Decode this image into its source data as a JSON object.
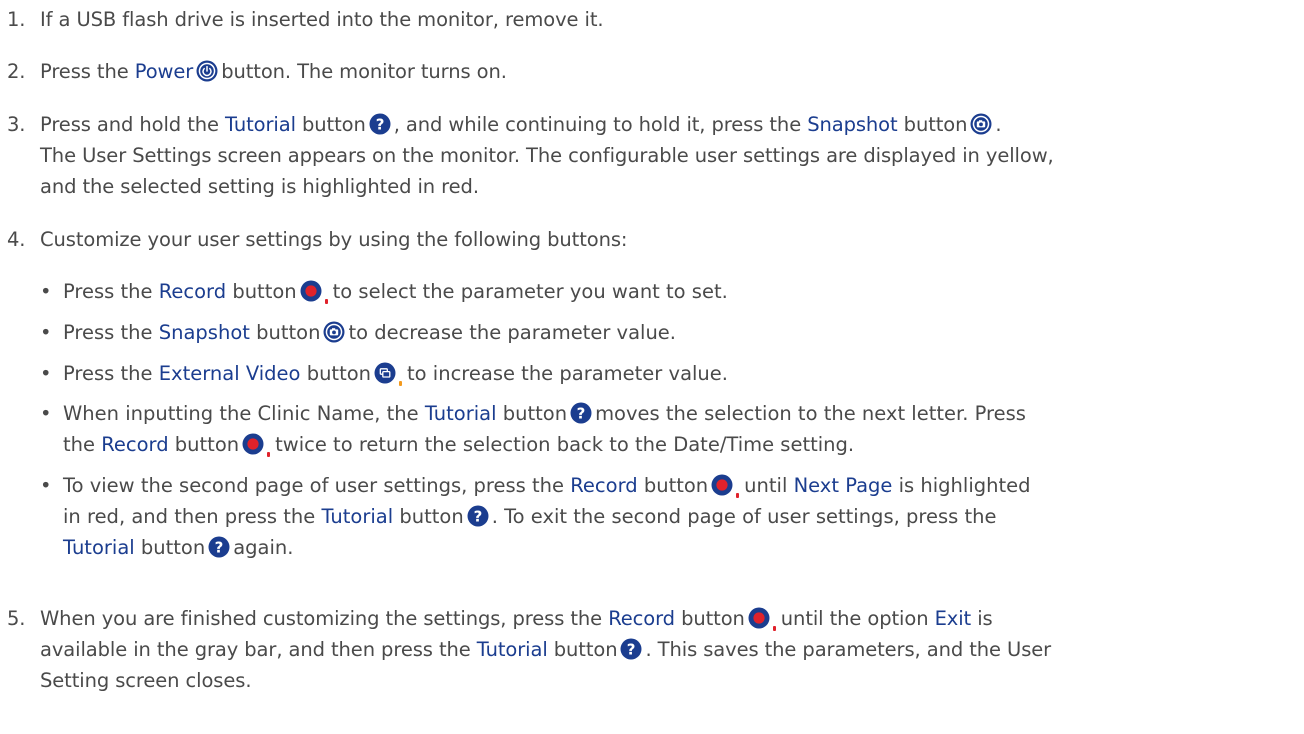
{
  "steps": [
    {
      "num": "1.",
      "text": "If a USB flash drive is inserted into the monitor, remove it."
    },
    {
      "num": "2.",
      "a": "Press the",
      "b": "Power",
      "c": "button. The monitor turns on."
    },
    {
      "num": "3.",
      "a": "Press and hold the",
      "b": "Tutorial",
      "c": "button",
      "d": ", and while continuing to hold it, press the",
      "e": "Snapshot",
      "f": "button",
      "g": ".",
      "line2": "The User Settings screen appears on the monitor. The configurable user settings are displayed in yellow,",
      "line3": "and the selected setting is highlighted in red."
    },
    {
      "num": "4.",
      "text": "Customize your user settings by using the following buttons:"
    },
    {
      "num": "5.",
      "a": "When you are finished customizing the settings, press the",
      "b": "Record",
      "c": "button",
      "d": "until the option",
      "e": "Exit",
      "f": "is",
      "line2a": "available in the gray bar, and then press the",
      "line2b": "Tutorial",
      "line2c": "button",
      "line2d": ". This saves the parameters, and the User",
      "line3": "Setting screen closes."
    }
  ],
  "bullets": [
    {
      "a": "Press the",
      "b": "Record",
      "c": "button",
      "d": "to select the parameter you want to set."
    },
    {
      "a": "Press the",
      "b": "Snapshot",
      "c": "button",
      "d": "to decrease the parameter value."
    },
    {
      "a": "Press the",
      "b": "External Video",
      "c": "button",
      "d": "to increase the parameter value."
    },
    {
      "a": "When inputting the Clinic Name, the",
      "b": "Tutorial",
      "c": "button",
      "d": "moves the selection to the next letter. Press",
      "e": "the",
      "f": "Record",
      "g": "button",
      "h": "twice to return the selection back to the Date/Time setting."
    },
    {
      "a": "To view the second page of user settings, press the",
      "b": "Record",
      "c": "button",
      "d": "until",
      "e": "Next Page",
      "f": "is highlighted",
      "g": "in red, and then press the",
      "h": "Tutorial",
      "i": "button",
      "j": ". To exit the second page of user settings, press the",
      "k": "Tutorial",
      "l": "button",
      "m": "again."
    }
  ],
  "bullet_char": "•",
  "colors": {
    "text": "#4a4a4a",
    "emphasis": "#1b3d8f",
    "icon_blue": "#1b3d8f",
    "record_red": "#e0222b",
    "ext_video_tick": "#f39a1e"
  },
  "icons": [
    "power-icon",
    "tutorial-question-icon",
    "snapshot-camera-icon",
    "record-icon",
    "external-video-icon"
  ]
}
